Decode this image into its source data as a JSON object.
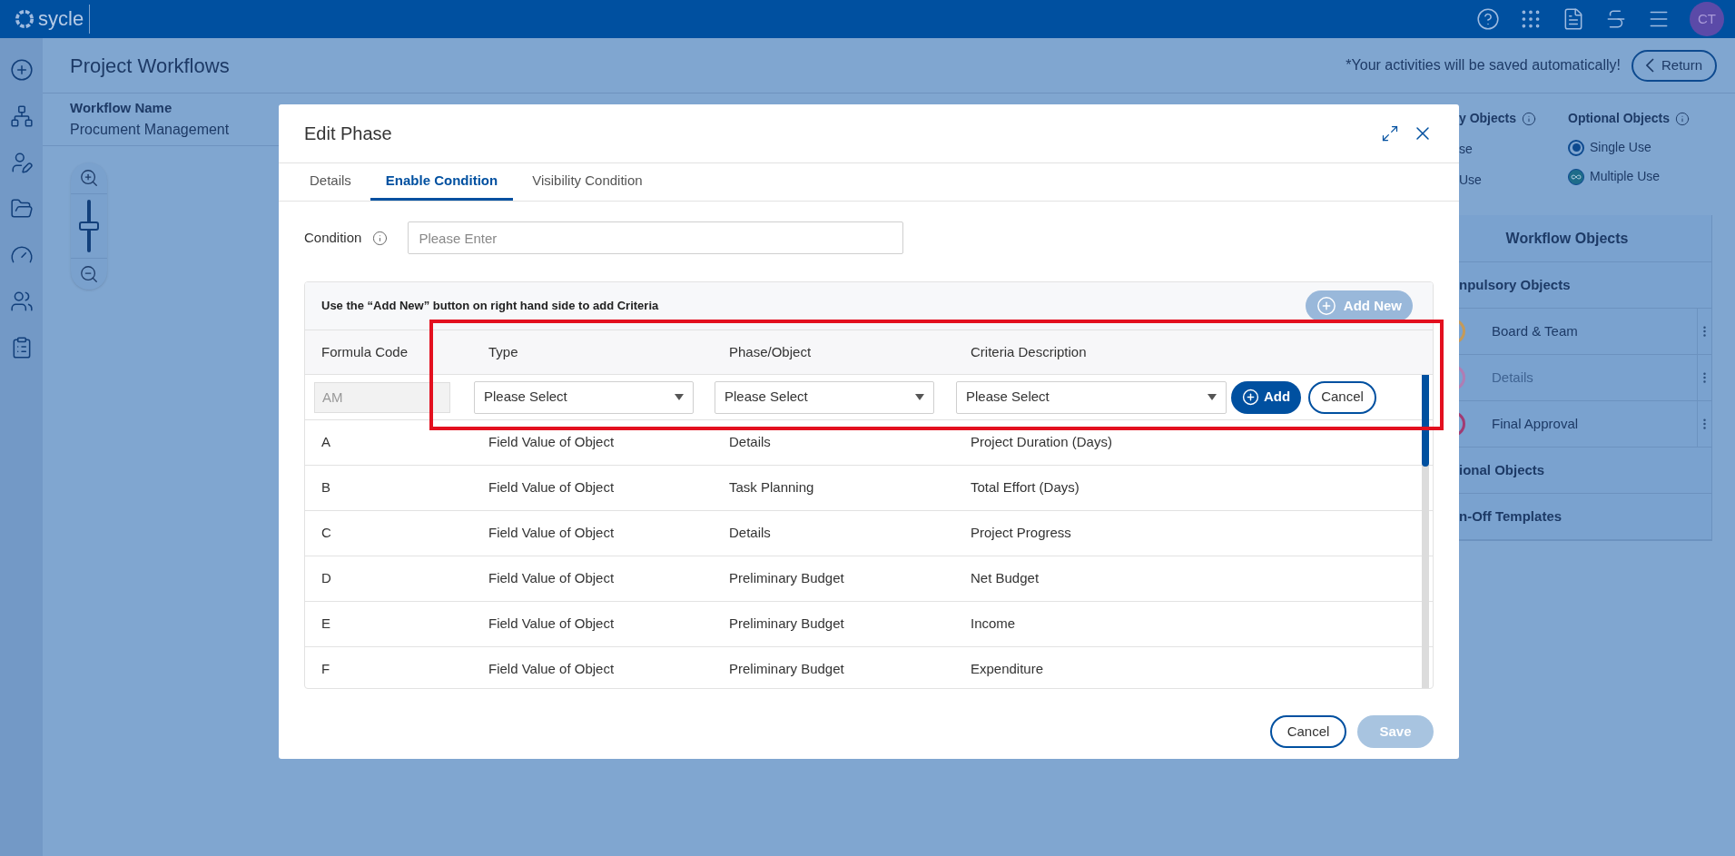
{
  "top_bar": {
    "logo": "sycle",
    "avatar": "CT"
  },
  "page": {
    "title": "Project Workflows",
    "autosave_note": "*Your activities will be saved automatically!",
    "return_button": "Return"
  },
  "workflow": {
    "label": "Workflow Name",
    "value": "Procument Management"
  },
  "zoom": {
    "level": 0.5
  },
  "legend": {
    "compulsory_title": "y Objects",
    "compulsory_options": [
      "se",
      "Use"
    ],
    "optional_title": "Optional Objects",
    "optional_options": [
      {
        "label": "Single Use",
        "kind": "single"
      },
      {
        "label": "Multiple Use",
        "kind": "multiple"
      }
    ]
  },
  "objects_panel": {
    "title": "Workflow Objects",
    "sections": [
      {
        "label": "npulsory Objects",
        "items": [
          {
            "label": "Board & Team",
            "color": "#c49a5a",
            "disabled": false
          },
          {
            "label": "Details",
            "color": "#b07db4",
            "disabled": true
          },
          {
            "label": "Final Approval",
            "color": "#a23a72",
            "disabled": false
          }
        ]
      },
      {
        "label": "ional Objects"
      },
      {
        "label": "n-Off Templates"
      }
    ]
  },
  "modal": {
    "title": "Edit Phase",
    "tabs": [
      {
        "label": "Details",
        "selected": false
      },
      {
        "label": "Enable Condition",
        "selected": true
      },
      {
        "label": "Visibility Condition",
        "selected": false
      }
    ],
    "condition": {
      "label": "Condition",
      "placeholder": "Please Enter"
    },
    "criteria": {
      "hint": "Use the “Add New” button on right hand side to add Criteria",
      "add_new": "Add New",
      "columns": [
        "Formula Code",
        "Type",
        "Phase/Object",
        "Criteria Description"
      ],
      "new_row": {
        "formula_code": "AM",
        "selects": [
          "Please Select",
          "Please Select",
          "Please Select"
        ],
        "add": "Add",
        "cancel": "Cancel"
      },
      "rows": [
        [
          "A",
          "Field Value of Object",
          "Details",
          "Project Duration (Days)"
        ],
        [
          "B",
          "Field Value of Object",
          "Task Planning",
          "Total Effort (Days)"
        ],
        [
          "C",
          "Field Value of Object",
          "Details",
          "Project Progress"
        ],
        [
          "D",
          "Field Value of Object",
          "Preliminary Budget",
          "Net Budget"
        ],
        [
          "E",
          "Field Value of Object",
          "Preliminary Budget",
          "Income"
        ],
        [
          "F",
          "Field Value of Object",
          "Preliminary Budget",
          "Expenditure"
        ]
      ]
    },
    "footer": {
      "cancel": "Cancel",
      "save": "Save",
      "save_disabled": true
    }
  }
}
